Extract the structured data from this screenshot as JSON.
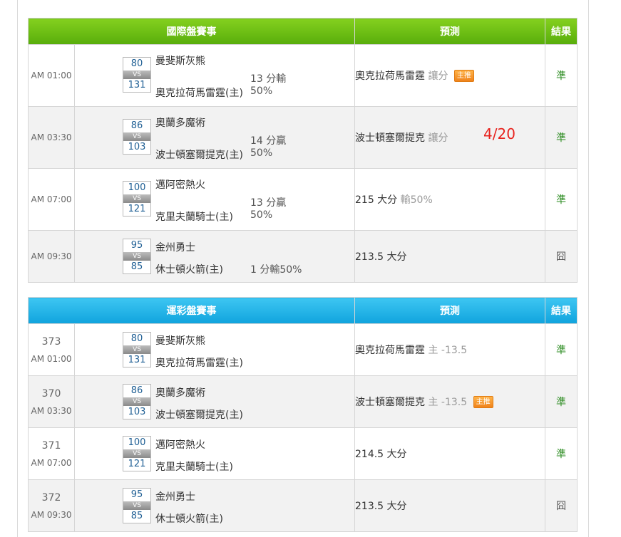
{
  "intl": {
    "header": {
      "event": "國際盤賽事",
      "prediction": "預測",
      "result": "結果"
    },
    "rows": [
      {
        "time": "AM 01:00",
        "score_away": "80",
        "score_home": "131",
        "vs": "VS",
        "team_away": "曼斐斯灰熊",
        "team_home": "奧克拉荷馬雷霆(主)",
        "hc1": "13 分輸",
        "hc2": "50%",
        "pick": "奧克拉荷馬雷霆",
        "pick_type": "讓分",
        "badge": "主推",
        "result": "準",
        "result_kind": "win"
      },
      {
        "time": "AM 03:30",
        "score_away": "86",
        "score_home": "103",
        "vs": "VS",
        "team_away": "奧蘭多魔術",
        "team_home": "波士頓塞爾提克(主)",
        "hc1": "14 分贏",
        "hc2": "50%",
        "pick": "波士頓塞爾提克",
        "pick_type": "讓分",
        "overlay": "4/20",
        "result": "準",
        "result_kind": "win"
      },
      {
        "time": "AM 07:00",
        "score_away": "100",
        "score_home": "121",
        "vs": "VS",
        "team_away": "邁阿密熱火",
        "team_home": "克里夫蘭騎士(主)",
        "hc1": "13 分贏",
        "hc2": "50%",
        "pick": "215 大分",
        "pick_type": "輸50%",
        "result": "準",
        "result_kind": "win"
      },
      {
        "time": "AM 09:30",
        "score_away": "95",
        "score_home": "85",
        "vs": "VS",
        "team_away": "金州勇士",
        "team_home": "休士頓火箭(主)",
        "hc1": "1 分輸50%",
        "pick": "213.5 大分",
        "result": "囧",
        "result_kind": "lose"
      }
    ]
  },
  "sports": {
    "header": {
      "event": "運彩盤賽事",
      "prediction": "預測",
      "result": "結果"
    },
    "rows": [
      {
        "game_no": "373",
        "time": "AM 01:00",
        "score_away": "80",
        "score_home": "131",
        "vs": "VS",
        "team_away": "曼斐斯灰熊",
        "team_home": "奧克拉荷馬雷霆(主)",
        "pick": "奧克拉荷馬雷霆",
        "pick_type": "主 -13.5",
        "result": "準",
        "result_kind": "win"
      },
      {
        "game_no": "370",
        "time": "AM 03:30",
        "score_away": "86",
        "score_home": "103",
        "vs": "VS",
        "team_away": "奧蘭多魔術",
        "team_home": "波士頓塞爾提克(主)",
        "pick": "波士頓塞爾提克",
        "pick_type": "主 -13.5",
        "badge": "主推",
        "result": "準",
        "result_kind": "win"
      },
      {
        "game_no": "371",
        "time": "AM 07:00",
        "score_away": "100",
        "score_home": "121",
        "vs": "VS",
        "team_away": "邁阿密熱火",
        "team_home": "克里夫蘭騎士(主)",
        "pick": "214.5 大分",
        "result": "準",
        "result_kind": "win"
      },
      {
        "game_no": "372",
        "time": "AM 09:30",
        "score_away": "95",
        "score_home": "85",
        "vs": "VS",
        "team_away": "金州勇士",
        "team_home": "休士頓火箭(主)",
        "pick": "213.5 大分",
        "result": "囧",
        "result_kind": "lose"
      }
    ]
  },
  "colors": {
    "win": "#2a8b1f",
    "lose": "#555555",
    "overlay": "#e8231e",
    "intl_header": "#6cc016",
    "sports_header": "#22b4e8"
  }
}
